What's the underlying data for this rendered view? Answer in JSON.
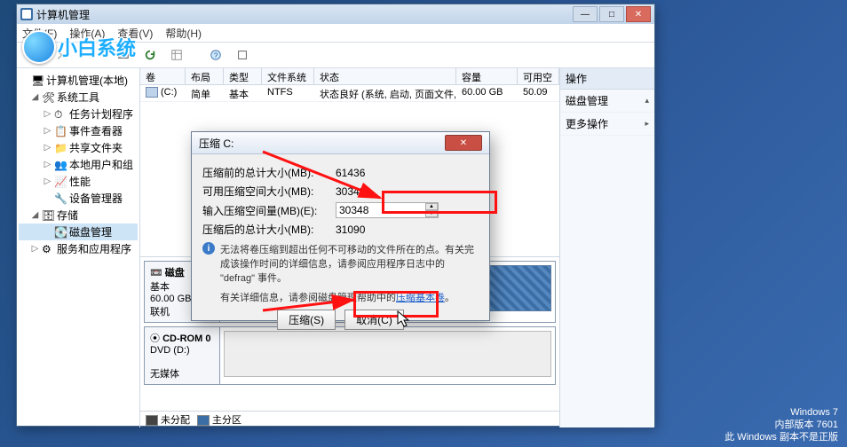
{
  "window": {
    "title": "计算机管理",
    "menus": [
      "文件(F)",
      "操作(A)",
      "查看(V)",
      "帮助(H)"
    ]
  },
  "tree": {
    "root": "计算机管理(本地)",
    "group_tools": "系统工具",
    "task_scheduler": "任务计划程序",
    "event_viewer": "事件查看器",
    "shared_folders": "共享文件夹",
    "local_users": "本地用户和组",
    "performance": "性能",
    "device_manager": "设备管理器",
    "group_storage": "存储",
    "disk_mgmt": "磁盘管理",
    "services_apps": "服务和应用程序"
  },
  "vol_header": {
    "vol": "卷",
    "layout": "布局",
    "type": "类型",
    "fs": "文件系统",
    "status": "状态",
    "cap": "容量",
    "free": "可用空"
  },
  "vol_row": {
    "vol": "(C:)",
    "layout": "简单",
    "type": "基本",
    "fs": "NTFS",
    "status": "状态良好 (系统, 启动, 页面文件, 活动, 故障转储, 主分区)",
    "cap": "60.00 GB",
    "free": "50.09"
  },
  "disk0": {
    "head_icon": "📼",
    "name": "磁盘",
    "sub": "基本",
    "size": "60.00 GB",
    "state": "联机"
  },
  "cdrom": {
    "icon": "⦿",
    "name": "CD-ROM 0",
    "line2": "DVD (D:)",
    "line3": "无媒体"
  },
  "legend": {
    "unalloc": "未分配",
    "primary": "主分区"
  },
  "actions": {
    "header": "操作",
    "disk": "磁盘管理",
    "more": "更多操作"
  },
  "dialog": {
    "title": "压缩 C:",
    "row1": "压缩前的总计大小(MB):",
    "val1": "61436",
    "row2": "可用压缩空间大小(MB):",
    "val2": "30348",
    "row3": "输入压缩空间量(MB)(E):",
    "val3": "30348",
    "row4": "压缩后的总计大小(MB):",
    "val4": "31090",
    "note": "无法将卷压缩到超出任何不可移动的文件所在的点。有关完成该操作时间的详细信息，请参阅应用程序日志中的 \"defrag\" 事件。",
    "note2a": "有关详细信息，请参阅磁盘管理帮助中的",
    "note2link": "压缩基本卷",
    "note2b": "。",
    "btn_shrink": "压缩(S)",
    "btn_cancel": "取消(C)"
  },
  "watermark": {
    "l1": "Windows 7",
    "l2": "内部版本 7601",
    "l3": "此 Windows 副本不是正版"
  }
}
